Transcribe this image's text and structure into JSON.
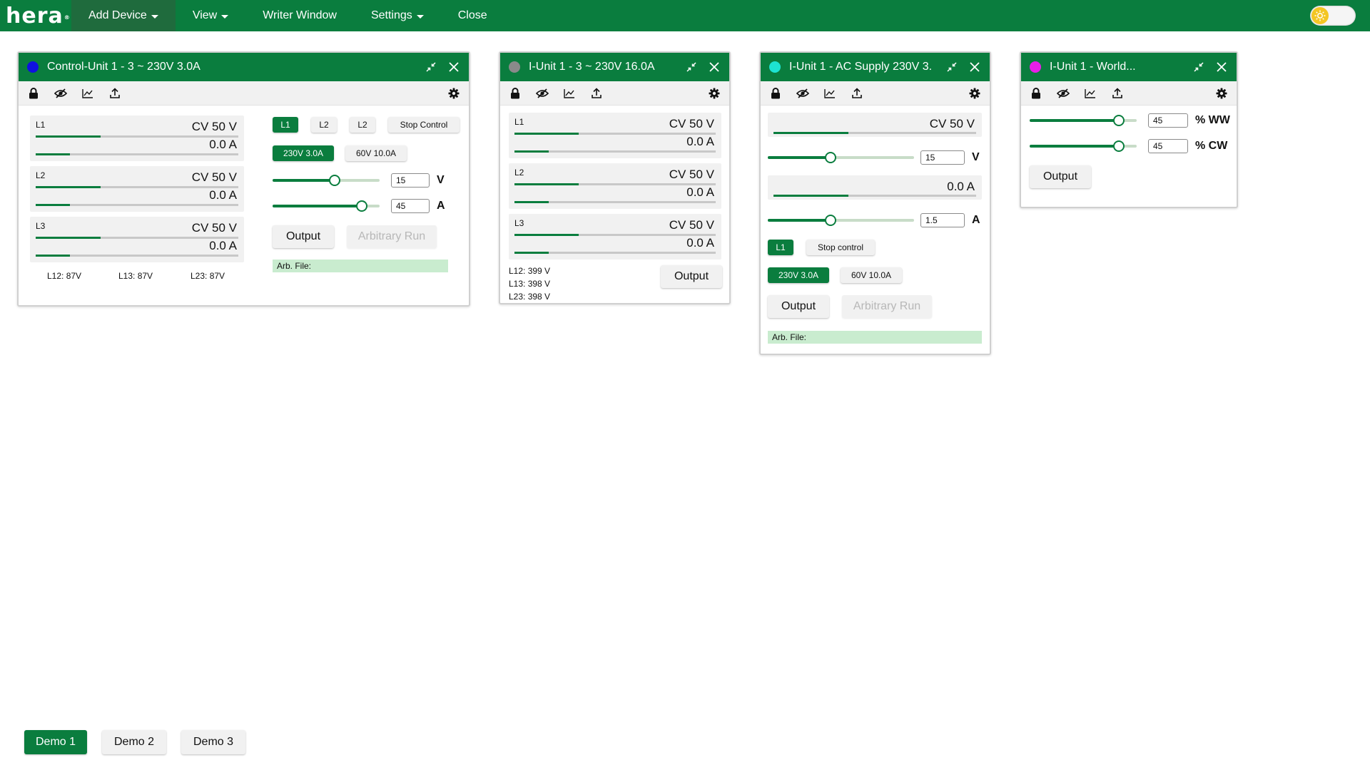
{
  "topbar": {
    "logo": "hera",
    "logo_mark": "®",
    "menu": [
      "Add Device",
      "View",
      "Writer Window",
      "Settings",
      "Close"
    ],
    "theme_icon": "sun-icon"
  },
  "colors": {
    "brand_green": "#0a7d3e",
    "dot_control_unit": "#1010e0",
    "dot_iunit_3": "#8a8a8a",
    "dot_iunit_ac": "#1de2d2",
    "dot_iunit_world": "#e81ee8"
  },
  "w1": {
    "title": "Control-Unit 1 - 3 ~ 230V 3.0A",
    "phases": [
      {
        "label": "L1",
        "voltage": "CV 50 V",
        "current": "0.0 A",
        "v_level": 0.32,
        "i_level": 0.17
      },
      {
        "label": "L2",
        "voltage": "CV 50 V",
        "current": "0.0 A",
        "v_level": 0.32,
        "i_level": 0.17
      },
      {
        "label": "L3",
        "voltage": "CV 50 V",
        "current": "0.0 A",
        "v_level": 0.32,
        "i_level": 0.17
      }
    ],
    "line_voltages": [
      "L12: 87V",
      "L13: 87V",
      "L23: 87V"
    ],
    "phase_buttons": [
      "L1",
      "L2",
      "L2"
    ],
    "stop_control": "Stop Control",
    "range_buttons": [
      "230V 3.0A",
      "60V 10.0A"
    ],
    "voltage_value": "15",
    "voltage_unit": "V",
    "voltage_level": 0.58,
    "current_value": "45",
    "current_unit": "A",
    "current_level": 0.83,
    "output": "Output",
    "arbitrary_run": "Arbitrary Run",
    "arb_file": "Arb. File:"
  },
  "w2": {
    "title": "I-Unit 1 - 3 ~ 230V 16.0A",
    "phases": [
      {
        "label": "L1",
        "voltage": "CV 50 V",
        "current": "0.0 A",
        "v_level": 0.32,
        "i_level": 0.17
      },
      {
        "label": "L2",
        "voltage": "CV 50 V",
        "current": "0.0 A",
        "v_level": 0.32,
        "i_level": 0.17
      },
      {
        "label": "L3",
        "voltage": "CV 50 V",
        "current": "0.0 A",
        "v_level": 0.32,
        "i_level": 0.17
      }
    ],
    "line_voltages": [
      "L12: 399 V",
      "L13: 398 V",
      "L23: 398 V"
    ],
    "output": "Output"
  },
  "w3": {
    "title": "I-Unit 1 - AC Supply 230V 3.",
    "voltage_display": "CV 50 V",
    "voltage_bar_level": 0.37,
    "voltage_value": "15",
    "voltage_unit": "V",
    "voltage_level": 0.43,
    "current_display": "0.0 A",
    "current_bar_level": 0.37,
    "current_value": "1.5",
    "current_unit": "A",
    "current_level": 0.43,
    "phase_button": "L1",
    "stop_control": "Stop control",
    "range_buttons": [
      "230V 3.0A",
      "60V 10.0A"
    ],
    "output": "Output",
    "arbitrary_run": "Arbitrary Run",
    "arb_file": "Arb. File:"
  },
  "w4": {
    "title": "I-Unit 1 - World...",
    "ww_value": "45",
    "ww_unit": "% WW",
    "ww_level": 0.83,
    "cw_value": "45",
    "cw_unit": "% CW",
    "cw_level": 0.83,
    "output": "Output"
  },
  "demos": [
    "Demo 1",
    "Demo 2",
    "Demo 3"
  ]
}
